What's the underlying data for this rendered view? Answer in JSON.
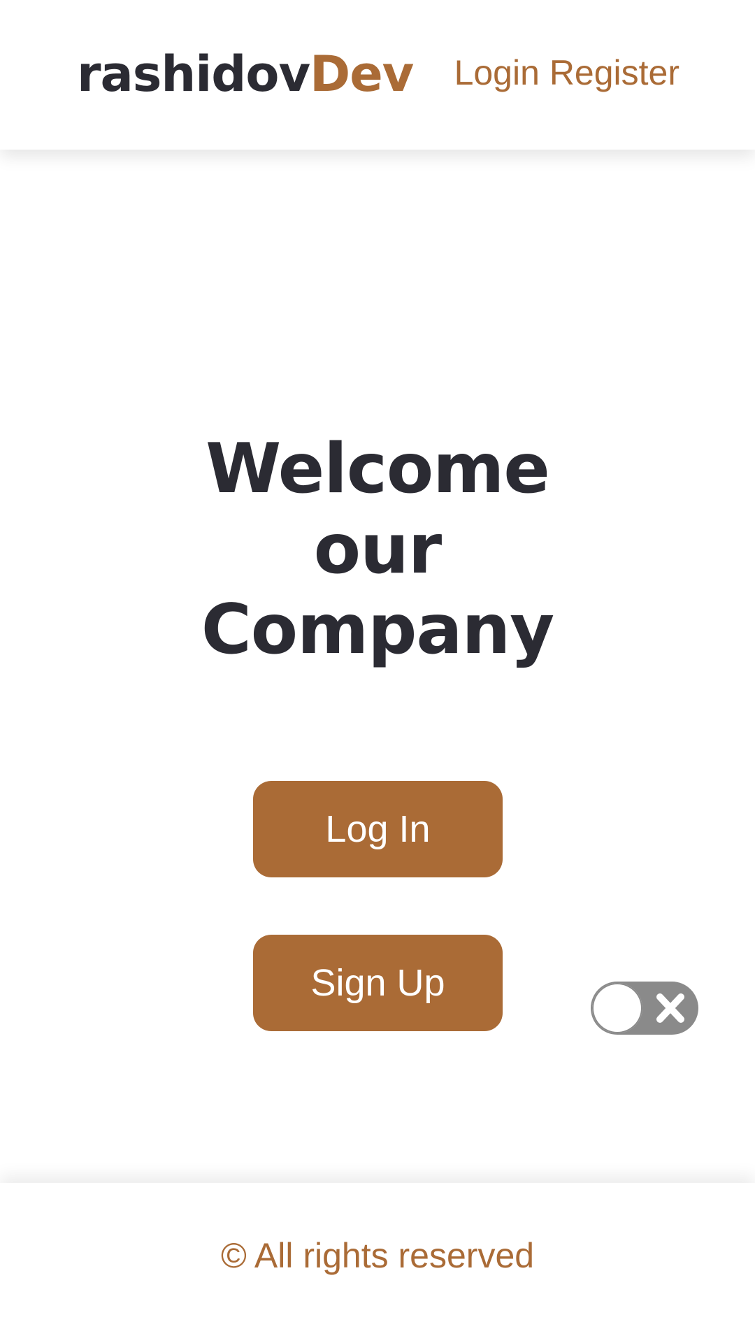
{
  "header": {
    "logo_part1": "rashidov",
    "logo_part2": "Dev",
    "nav": {
      "login": "Login",
      "register": "Register"
    }
  },
  "hero": {
    "title_line1": "Welcome",
    "title_line2": "our",
    "title_line3": "Company"
  },
  "actions": {
    "login_label": "Log In",
    "signup_label": "Sign Up"
  },
  "toggle": {
    "state": "off",
    "icon": "close-icon"
  },
  "footer": {
    "text": "© All rights reserved"
  },
  "colors": {
    "accent": "#aa6b36",
    "text_dark": "#2b2b33",
    "toggle_track": "#8a8a8a"
  }
}
